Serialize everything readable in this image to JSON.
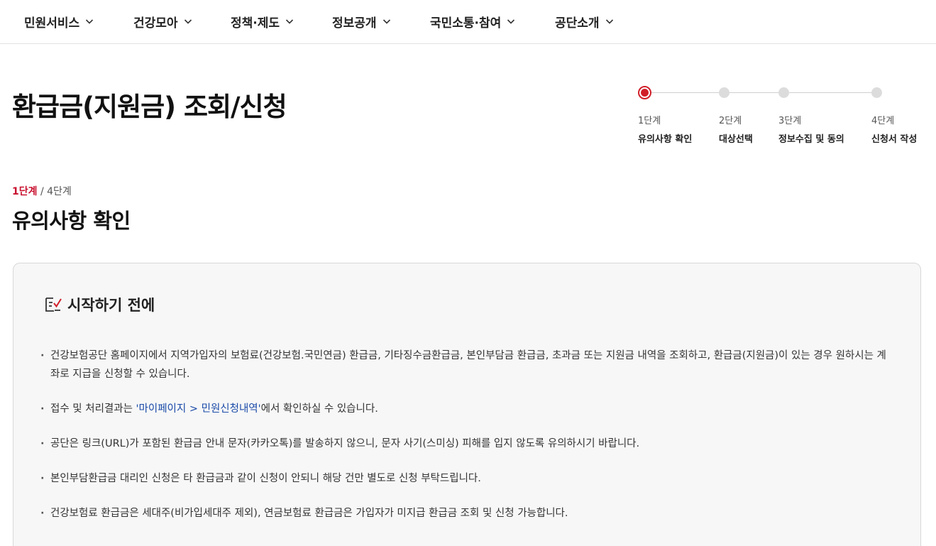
{
  "nav": {
    "items": [
      {
        "label": "민원서비스"
      },
      {
        "label": "건강모아"
      },
      {
        "label": "정책·제도"
      },
      {
        "label": "정보공개"
      },
      {
        "label": "국민소통·참여"
      },
      {
        "label": "공단소개"
      }
    ]
  },
  "page": {
    "title": "환급금(지원금) 조회/신청"
  },
  "stepper": {
    "steps": [
      {
        "num": "1단계",
        "label": "유의사항 확인",
        "active": true
      },
      {
        "num": "2단계",
        "label": "대상선택",
        "active": false
      },
      {
        "num": "3단계",
        "label": "정보수집 및 동의",
        "active": false
      },
      {
        "num": "4단계",
        "label": "신청서 작성",
        "active": false
      }
    ]
  },
  "progress": {
    "current": "1단계",
    "separator": "/",
    "total": "4단계"
  },
  "section": {
    "title": "유의사항 확인"
  },
  "notice": {
    "title": "시작하기 전에",
    "item1": "건강보험공단 홈페이지에서 지역가입자의 보험료(건강보험.국민연금) 환급금, 기타징수금환급금, 본인부담금 환급금, 초과금 또는 지원금 내역을 조회하고, 환급금(지원금)이 있는 경우 원하시는 계좌로 지급을 신청할 수 있습니다.",
    "item2_before": "접수 및 처리결과는 ",
    "item2_link": "'마이페이지 > 민원신청내역'",
    "item2_after": "에서 확인하실 수 있습니다.",
    "item3": "공단은 링크(URL)가 포함된 환급금 안내 문자(카카오톡)를 발송하지 않으니, 문자 사기(스미싱) 피해를 입지 않도록 유의하시기 바랍니다.",
    "item4": "본인부담환급금 대리인 신청은 타 환급금과 같이 신청이 안되니 해당 건만 별도로 신청 부탁드립니다.",
    "item5": "건강보험료 환급금은 세대주(비가입세대주 제외), 연금보험료 환급금은 가입자가 미지급 환급금 조회 및 신청 가능합니다."
  },
  "colors": {
    "accent": "#d11f29",
    "link": "#1a4aa8",
    "panel_bg": "#f7f7f7"
  }
}
